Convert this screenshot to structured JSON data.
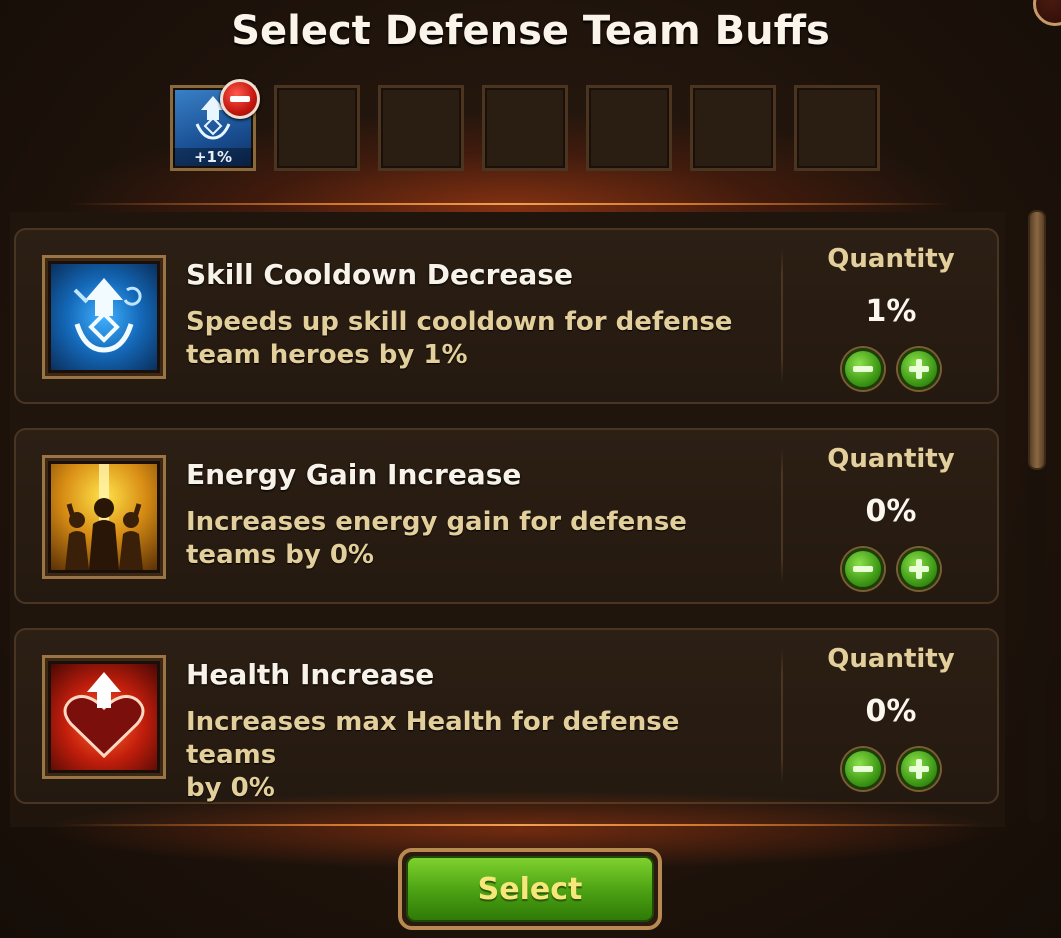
{
  "title": "Select Defense Team Buffs",
  "slots": {
    "filled_percent": "+1%",
    "count": 7,
    "filled_icon": "skill-cooldown-icon",
    "remove_icon": "minus-circle-icon"
  },
  "buffs": [
    {
      "name": "Skill Cooldown Decrease",
      "description_line1": "Speeds up skill cooldown for defense",
      "description_line2": "team heroes by 1%",
      "quantity_label": "Quantity",
      "quantity": "1%",
      "icon": "skill-cooldown-icon"
    },
    {
      "name": "Energy Gain Increase",
      "description_line1": "Increases energy gain for defense",
      "description_line2": "teams by 0%",
      "quantity_label": "Quantity",
      "quantity": "0%",
      "icon": "energy-crowd-icon"
    },
    {
      "name": "Health Increase",
      "description_line1": "Increases max Health for defense teams",
      "description_line2": "by 0%",
      "quantity_label": "Quantity",
      "quantity": "0%",
      "icon": "heart-up-icon"
    }
  ],
  "select_button": "Select",
  "colors": {
    "accent_green": "#4aa012",
    "gold_text": "#e3cf9b",
    "background": "#20140c"
  }
}
